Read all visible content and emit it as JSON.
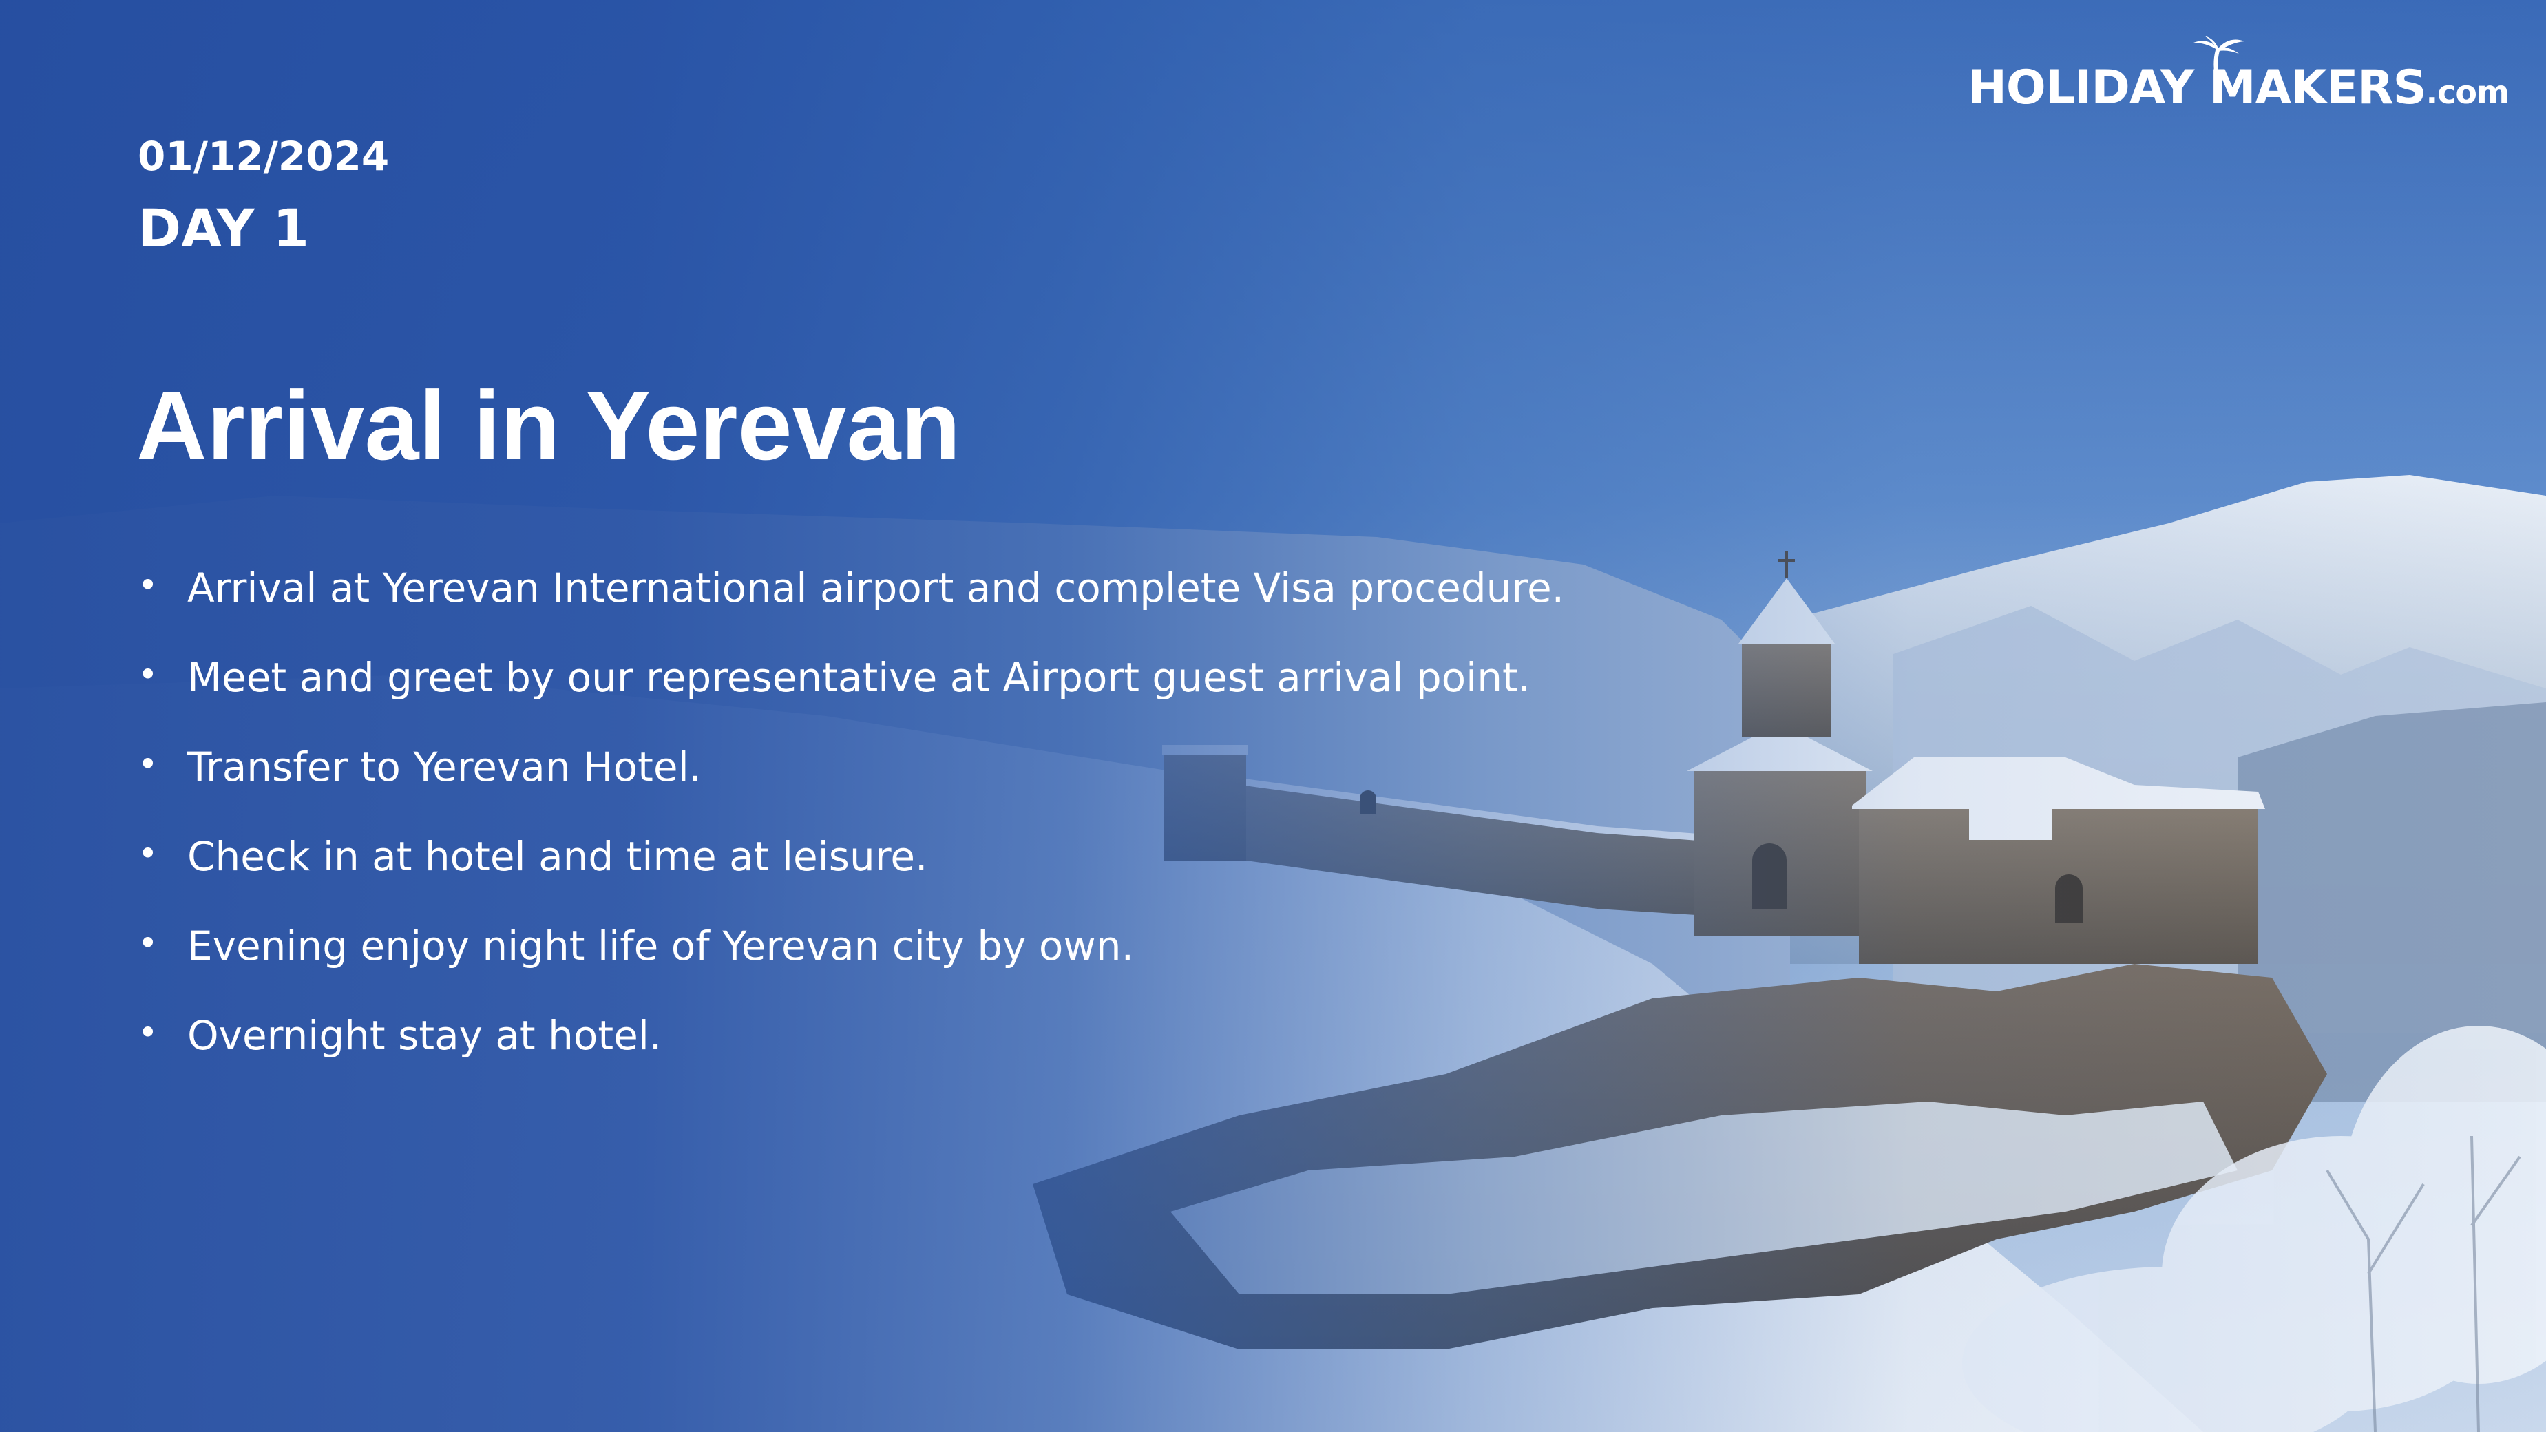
{
  "brand": {
    "logo_main": "HOLIDAY MAKERS",
    "logo_tld": ".com"
  },
  "itinerary": {
    "date": "01/12/2024",
    "day_label": "DAY 1",
    "title": "Arrival in Yerevan",
    "bullet_glyph": "•",
    "items": [
      "Arrival at Yerevan International airport and complete Visa procedure.",
      "Meet and greet by our representative at Airport guest arrival point.",
      "Transfer to Yerevan Hotel.",
      "Check in at hotel and time at leisure.",
      "Evening enjoy night life of Yerevan city by own.",
      "Overnight stay at hotel."
    ]
  },
  "colors": {
    "overlay_blue": "#2a5aa8",
    "snow": "#eef3fa",
    "stone": "#6e665c",
    "text": "#ffffff"
  }
}
